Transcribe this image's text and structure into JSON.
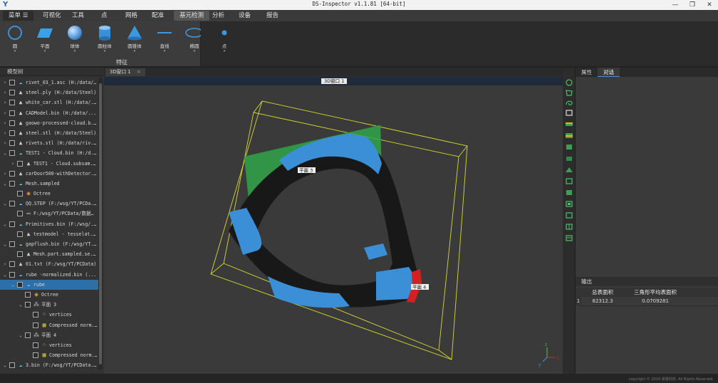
{
  "window": {
    "title": "DS-Inspector v1.1.81 [64-bit]",
    "minimize_glyph": "—",
    "maximize_glyph": "❐",
    "close_glyph": "✕"
  },
  "menubar": {
    "items": [
      {
        "label": "菜单 ☰"
      },
      {
        "label": "可视化"
      },
      {
        "label": "工具"
      },
      {
        "label": "点"
      },
      {
        "label": "网格"
      },
      {
        "label": "配准"
      },
      {
        "label": "基元检测",
        "active": true
      },
      {
        "label": "分析"
      },
      {
        "label": "设备"
      },
      {
        "label": "报告"
      }
    ]
  },
  "ribbon": {
    "group_label": "特征",
    "tools": [
      {
        "label": "圆",
        "icon": "circle-icon"
      },
      {
        "label": "平面",
        "icon": "plane-icon"
      },
      {
        "label": "球体",
        "icon": "sphere-icon"
      },
      {
        "label": "圆柱体",
        "icon": "cylinder-icon"
      },
      {
        "label": "圆锥体",
        "icon": "cone-icon"
      },
      {
        "label": "直线",
        "icon": "line-icon"
      },
      {
        "label": "椭圆",
        "icon": "ellipse-icon"
      },
      {
        "label": "点",
        "icon": "point-icon"
      }
    ],
    "caret": "▾"
  },
  "model_tree": {
    "title": "模型树",
    "rows": [
      {
        "indent": 0,
        "arrow": "›",
        "icon": "cloud-icon",
        "text": "rivet_03_1.asc (H:/data/..."
      },
      {
        "indent": 0,
        "arrow": "›",
        "icon": "mesh-icon",
        "text": "steel.ply (H:/data/Steel)"
      },
      {
        "indent": 0,
        "arrow": "›",
        "icon": "mesh-icon",
        "text": "white_car.stl (H:/data/..."
      },
      {
        "indent": 0,
        "arrow": "›",
        "icon": "mesh-icon",
        "text": "CADModel.bin (H:/data/..."
      },
      {
        "indent": 0,
        "arrow": "›",
        "icon": "mesh-icon",
        "text": "gaowo-processed-cloud.b..."
      },
      {
        "indent": 0,
        "arrow": "›",
        "icon": "mesh-icon",
        "text": "steel.stl (H:/data/Steel)"
      },
      {
        "indent": 0,
        "arrow": "›",
        "icon": "mesh-icon",
        "text": "rivets.stl (H:/data/riv..."
      },
      {
        "indent": 0,
        "arrow": "⌄",
        "icon": "cloud-icon",
        "text": "TEST1 - Cloud.bin (H:/d..."
      },
      {
        "indent": 1,
        "arrow": "›",
        "icon": "mesh-icon",
        "text": "TEST1 - Cloud.subsam..."
      },
      {
        "indent": 0,
        "arrow": "›",
        "icon": "mesh-icon",
        "text": "carDoor500-withDetector..."
      },
      {
        "indent": 0,
        "arrow": "⌄",
        "icon": "cloud-icon",
        "text": "Mesh.sampled"
      },
      {
        "indent": 1,
        "arrow": "",
        "icon": "octree-icon",
        "text": "Octree"
      },
      {
        "indent": 0,
        "arrow": "⌄",
        "icon": "cloud-icon",
        "text": "QQ.STEP (F:/wsg/YT/PCDa..."
      },
      {
        "indent": 1,
        "arrow": "",
        "icon": "file-icon",
        "text": "F:/wsg/YT/PCData/数据文..."
      },
      {
        "indent": 0,
        "arrow": "⌄",
        "icon": "cloud-icon",
        "text": "Primitives.bin (F:/wsg/..."
      },
      {
        "indent": 1,
        "arrow": "",
        "icon": "mesh-icon",
        "text": "testmodel - tesselat..."
      },
      {
        "indent": 0,
        "arrow": "⌄",
        "icon": "cloud-icon",
        "text": "gapflush.bin (F:/wsg/YT..."
      },
      {
        "indent": 1,
        "arrow": "",
        "icon": "mesh-icon",
        "text": "Mesh.part.sampled.se..."
      },
      {
        "indent": 0,
        "arrow": "›",
        "icon": "mesh-icon",
        "text": "01.txt (F:/wsg/YT/PCData)"
      },
      {
        "indent": 0,
        "arrow": "⌄",
        "icon": "cloud-icon",
        "text": "rube -normalized.bin (..."
      },
      {
        "indent": 1,
        "arrow": "⌄",
        "icon": "cloud-icon",
        "text": "rube",
        "selected": true
      },
      {
        "indent": 2,
        "arrow": "",
        "icon": "octree-icon",
        "text": "Octree"
      },
      {
        "indent": 2,
        "arrow": "⌄",
        "icon": "plane-node-icon",
        "text": "平面 3"
      },
      {
        "indent": 3,
        "arrow": "",
        "icon": "vertices-icon",
        "text": "vertices"
      },
      {
        "indent": 3,
        "arrow": "",
        "icon": "compressed-icon",
        "text": "Compressed norm..."
      },
      {
        "indent": 2,
        "arrow": "⌄",
        "icon": "plane-node-icon",
        "text": "平面 4"
      },
      {
        "indent": 3,
        "arrow": "",
        "icon": "vertices-icon",
        "text": "vertices"
      },
      {
        "indent": 3,
        "arrow": "",
        "icon": "compressed-icon",
        "text": "Compressed norm..."
      },
      {
        "indent": 0,
        "arrow": "⌄",
        "icon": "cloud-icon",
        "text": "3.bin (F:/wsg/YT/PCData..."
      }
    ]
  },
  "viewport": {
    "tab_label": "3D窗口 1",
    "tab_close": "×",
    "view_title": "3D窗口 1",
    "labels": {
      "plane3": "平面 3",
      "plane4": "平面 4"
    },
    "axis_labels": {
      "x": "x",
      "y": "y",
      "z": "z"
    },
    "colors": {
      "background": "#3a3a3a",
      "bounding_box": "#e0e030",
      "plane3": "#2fa84a",
      "plane4": "#d42020",
      "surface": "#3a8fd6",
      "dark_surface": "#181818"
    }
  },
  "right_tabs": {
    "items": [
      {
        "label": "属性"
      },
      {
        "label": "对话",
        "active": true
      }
    ]
  },
  "output": {
    "title": "输出",
    "columns": [
      "总表面积",
      "三角形平均表面积"
    ],
    "rows": [
      {
        "index": "1",
        "cells": [
          "82312.3",
          "0.0709281"
        ]
      }
    ]
  },
  "statusbar": {
    "copyright": "copyright © 2024 易建科技. All Rights Reserved."
  }
}
